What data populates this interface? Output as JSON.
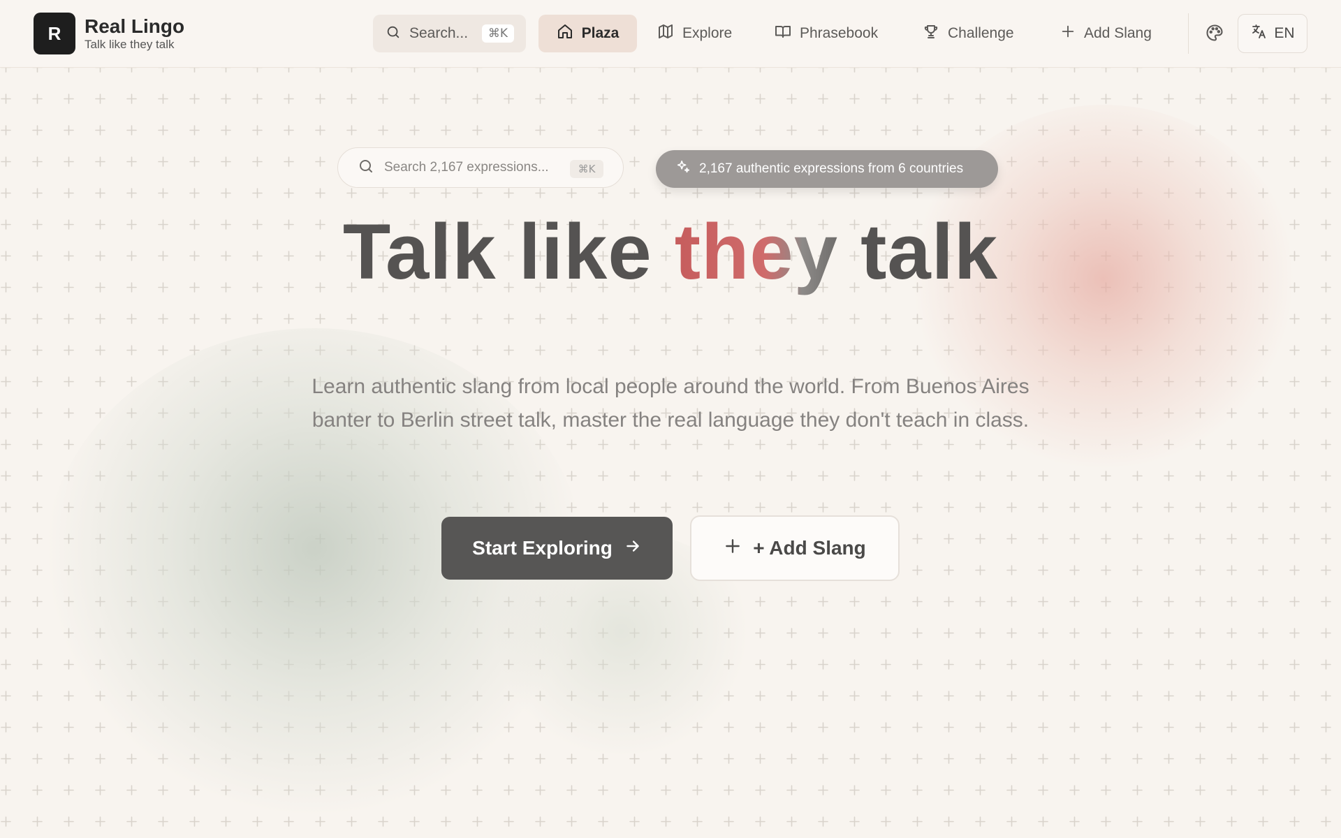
{
  "brand": {
    "badge": "R",
    "title": "Real Lingo",
    "subtitle": "Talk like they talk"
  },
  "nav": {
    "search_placeholder": "Search...",
    "search_shortcut": "⌘K",
    "items": [
      {
        "label": "Plaza",
        "icon": "home-icon",
        "active": true
      },
      {
        "label": "Explore",
        "icon": "map-icon",
        "active": false
      },
      {
        "label": "Phrasebook",
        "icon": "book-open-icon",
        "active": false
      },
      {
        "label": "Challenge",
        "icon": "trophy-icon",
        "active": false
      },
      {
        "label": "Add Slang",
        "icon": "plus-icon",
        "active": false
      }
    ],
    "theme_icon": "palette-icon",
    "language": "EN"
  },
  "hero": {
    "search_placeholder": "Search 2,167 expressions...",
    "search_shortcut": "⌘K",
    "stats_text": "2,167 authentic expressions from 6 countries",
    "headline_before": "Talk like ",
    "headline_accent": "they",
    "headline_after": " talk",
    "description": "Learn authentic slang from local people around the world. From Buenos Aires banter to Berlin street talk, master the real language they don't teach in class.",
    "primary_cta": "Start Exploring",
    "secondary_cta": "+ Add Slang"
  },
  "colors": {
    "background": "#f8f4ef",
    "accent": "#c65d5d",
    "primary_button": "#575655",
    "active_nav": "#eedfd6"
  }
}
